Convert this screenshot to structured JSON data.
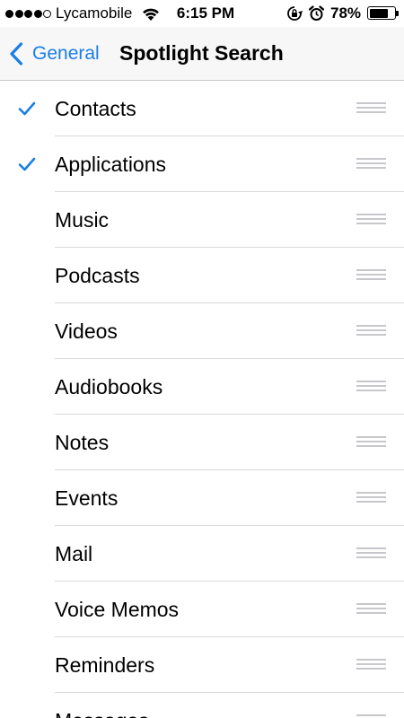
{
  "status_bar": {
    "signal_bars": 4,
    "signal_bars_max": 5,
    "carrier": "Lycamobile",
    "time": "6:15 PM",
    "battery_text": "78%",
    "battery_level": 0.78,
    "icons": [
      "signal-dots-icon",
      "wifi-icon",
      "rotation-lock-icon",
      "alarm-icon",
      "battery-icon"
    ]
  },
  "nav": {
    "back_label": "General",
    "title": "Spotlight Search",
    "accent_color": "#1a7ee6"
  },
  "items": [
    {
      "label": "Contacts",
      "checked": true
    },
    {
      "label": "Applications",
      "checked": true
    },
    {
      "label": "Music",
      "checked": false
    },
    {
      "label": "Podcasts",
      "checked": false
    },
    {
      "label": "Videos",
      "checked": false
    },
    {
      "label": "Audiobooks",
      "checked": false
    },
    {
      "label": "Notes",
      "checked": false
    },
    {
      "label": "Events",
      "checked": false
    },
    {
      "label": "Mail",
      "checked": false
    },
    {
      "label": "Voice Memos",
      "checked": false
    },
    {
      "label": "Reminders",
      "checked": false
    },
    {
      "label": "Messages",
      "checked": false
    }
  ]
}
